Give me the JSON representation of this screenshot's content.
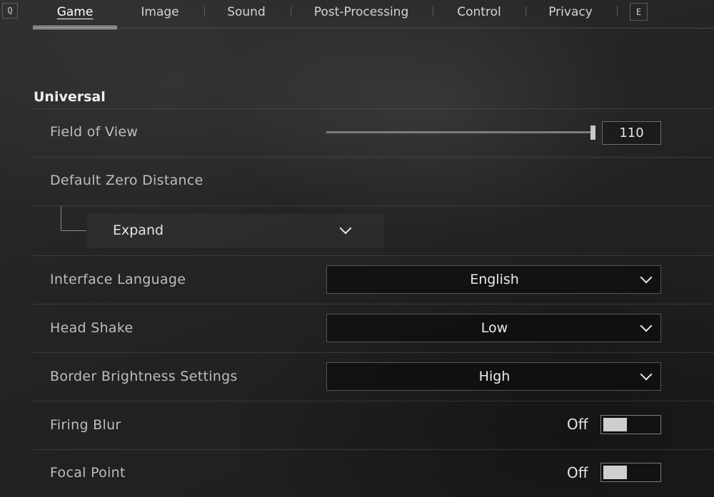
{
  "nav": {
    "prev_key": "Q",
    "next_key": "E",
    "tabs": [
      "Game",
      "Image",
      "Sound",
      "Post-Processing",
      "Control",
      "Privacy"
    ],
    "active_tab": "Game"
  },
  "section": {
    "title": "Universal"
  },
  "settings": {
    "fov": {
      "label": "Field of View",
      "value": "110",
      "level_fraction": 1.0
    },
    "zero": {
      "label": "Default Zero Distance",
      "expand_label": "Expand"
    },
    "language": {
      "label": "Interface Language",
      "value": "English"
    },
    "head_shake": {
      "label": "Head Shake",
      "value": "Low"
    },
    "border": {
      "label": "Border Brightness Settings",
      "value": "High"
    },
    "firing_blur": {
      "label": "Firing Blur",
      "value": "Off"
    },
    "focal_point": {
      "label": "Focal Point",
      "value": "Off"
    }
  },
  "colors": {
    "accent": "#ffffff",
    "toggle_knob": "#cfd0ce",
    "background": "#232425"
  },
  "icons": {
    "dropdown": "chevron-down-icon"
  }
}
